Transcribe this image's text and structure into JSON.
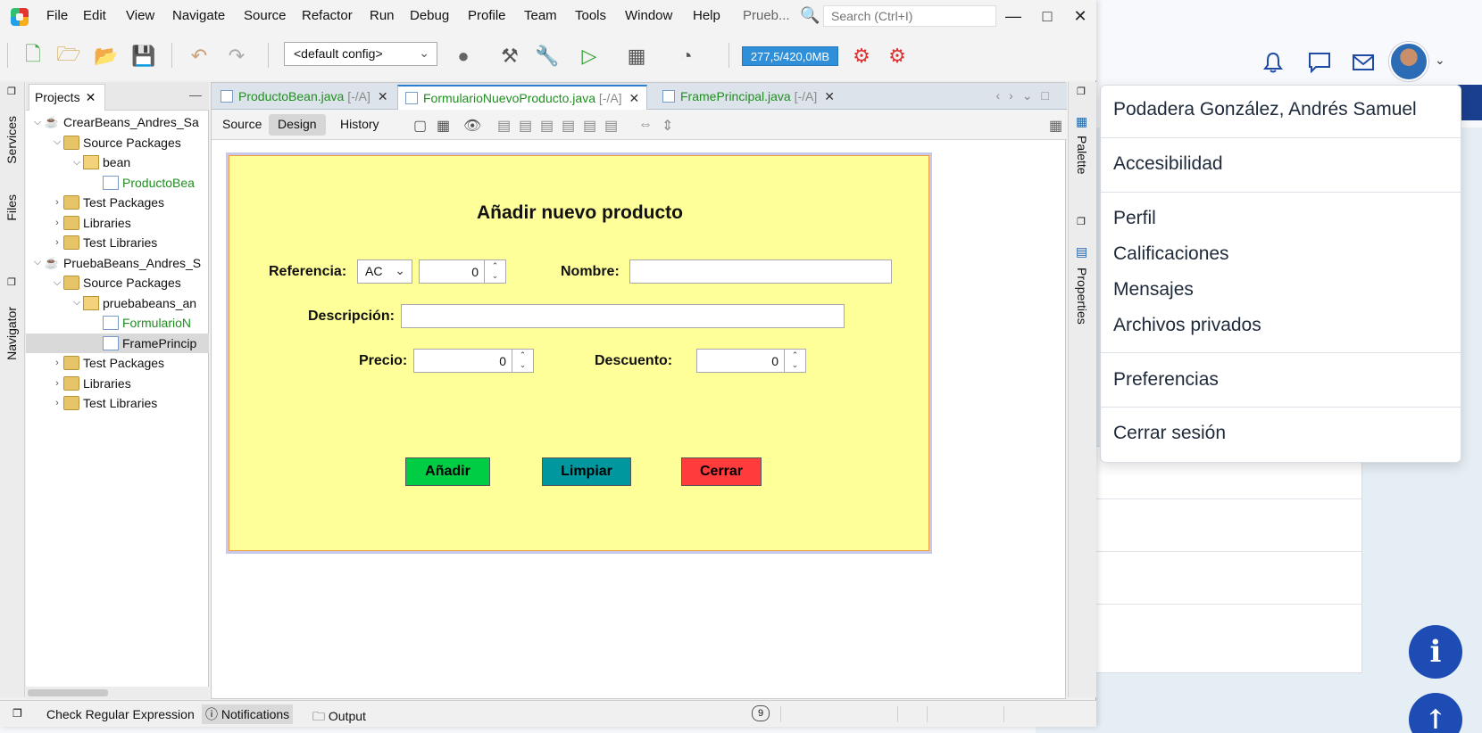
{
  "menubar": {
    "items": [
      "File",
      "Edit",
      "View",
      "Navigate",
      "Source",
      "Refactor",
      "Run",
      "Debug",
      "Profile",
      "Team",
      "Tools",
      "Window",
      "Help"
    ],
    "project_label": "Prueb...",
    "search_placeholder": "Search (Ctrl+I)"
  },
  "toolbar": {
    "config": "<default config>",
    "memory": "277,5/420,0MB"
  },
  "left_strip": {
    "services": "Services",
    "files": "Files",
    "navigator": "Navigator"
  },
  "projects": {
    "tab_label": "Projects",
    "tree": [
      {
        "label": "CrearBeans_Andres_Sa",
        "level": 0,
        "kind": "project",
        "expanded": true
      },
      {
        "label": "Source Packages",
        "level": 1,
        "kind": "folder",
        "expanded": true
      },
      {
        "label": "bean",
        "level": 2,
        "kind": "package",
        "expanded": true
      },
      {
        "label": "ProductoBea",
        "level": 3,
        "kind": "file",
        "green": true
      },
      {
        "label": "Test Packages",
        "level": 1,
        "kind": "folder",
        "expanded": false
      },
      {
        "label": "Libraries",
        "level": 1,
        "kind": "folder",
        "expanded": false
      },
      {
        "label": "Test Libraries",
        "level": 1,
        "kind": "folder",
        "expanded": false
      },
      {
        "label": "PruebaBeans_Andres_S",
        "level": 0,
        "kind": "project",
        "expanded": true
      },
      {
        "label": "Source Packages",
        "level": 1,
        "kind": "folder",
        "expanded": true
      },
      {
        "label": "pruebabeans_an",
        "level": 2,
        "kind": "package",
        "expanded": true
      },
      {
        "label": "FormularioN",
        "level": 3,
        "kind": "file",
        "green": true
      },
      {
        "label": "FramePrincip",
        "level": 3,
        "kind": "file",
        "green": false,
        "selected": true
      },
      {
        "label": "Test Packages",
        "level": 1,
        "kind": "folder",
        "expanded": false
      },
      {
        "label": "Libraries",
        "level": 1,
        "kind": "folder",
        "expanded": false
      },
      {
        "label": "Test Libraries",
        "level": 1,
        "kind": "folder",
        "expanded": false
      }
    ]
  },
  "editor": {
    "tabs": [
      {
        "name": "ProductoBean.java",
        "suffix": "[-/A]"
      },
      {
        "name": "FormularioNuevoProducto.java",
        "suffix": "[-/A]"
      },
      {
        "name": "FramePrincipal.java",
        "suffix": "[-/A]"
      }
    ],
    "subtabs": {
      "source": "Source",
      "design": "Design",
      "history": "History"
    }
  },
  "form": {
    "title": "Añadir nuevo producto",
    "referencia_label": "Referencia:",
    "referencia_combo": "AC",
    "referencia_spin": "0",
    "nombre_label": "Nombre:",
    "descripcion_label": "Descripción:",
    "precio_label": "Precio:",
    "precio_value": "0",
    "descuento_label": "Descuento:",
    "descuento_value": "0",
    "btn_add": "Añadir",
    "btn_clear": "Limpiar",
    "btn_close": "Cerrar",
    "colors": {
      "background": "#ffff99",
      "add": "#00cc44",
      "clear": "#00989e",
      "close": "#ff3b3b"
    }
  },
  "right_strip": {
    "palette": "Palette",
    "properties": "Properties"
  },
  "statusbar": {
    "check_regex": "Check Regular Expression",
    "notifications": "Notifications",
    "output": "Output",
    "badge": "9"
  },
  "user_menu": {
    "name": "Podadera González, Andrés Samuel",
    "accessibility": "Accesibilidad",
    "profile": "Perfil",
    "grades": "Calificaciones",
    "messages": "Mensajes",
    "private_files": "Archivos privados",
    "preferences": "Preferencias",
    "logout": "Cerrar sesión"
  }
}
